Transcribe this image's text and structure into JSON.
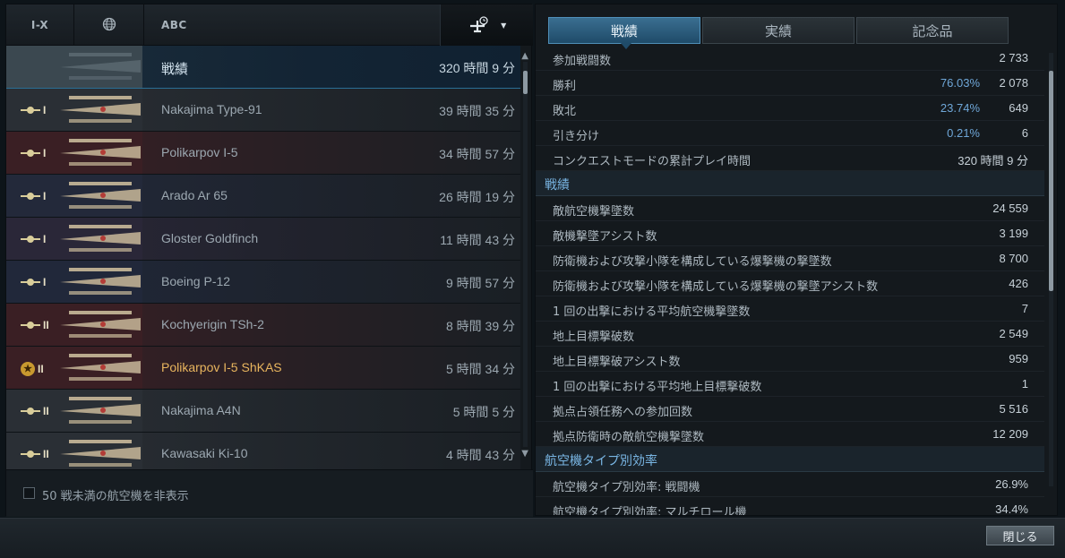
{
  "filters": {
    "tier_label": "I-X",
    "nation_icon": "globe-icon",
    "sort_label": "ABC",
    "sort_mode_icon": "plane-clock-icon"
  },
  "aircraft": [
    {
      "name": "戦績",
      "time": "320 時間 9 分",
      "tier": "",
      "type": "summary"
    },
    {
      "name": "Nakajima Type-91",
      "time": "39 時間 35 分",
      "tier": "I",
      "type": "normal",
      "tint": "#2a2f35"
    },
    {
      "name": "Polikarpov I-5",
      "time": "34 時間 57 分",
      "tier": "I",
      "type": "normal",
      "tint": "#3a1f24"
    },
    {
      "name": "Arado Ar 65",
      "time": "26 時間 19 分",
      "tier": "I",
      "type": "normal",
      "tint": "#23293a"
    },
    {
      "name": "Gloster Goldfinch",
      "time": "11 時間 43 分",
      "tier": "I",
      "type": "normal",
      "tint": "#2a2738"
    },
    {
      "name": "Boeing P-12",
      "time": "9 時間 57 分",
      "tier": "I",
      "type": "normal",
      "tint": "#21283a"
    },
    {
      "name": "Kochyerigin TSh-2",
      "time": "8 時間 39 分",
      "tier": "II",
      "type": "normal",
      "tint": "#3a1f24"
    },
    {
      "name": "Polikarpov I-5 ShKAS",
      "time": "5 時間 34 分",
      "tier": "II",
      "type": "premium",
      "tint": "#3a1f24"
    },
    {
      "name": "Nakajima A4N",
      "time": "5 時間 5 分",
      "tier": "II",
      "type": "normal",
      "tint": "#2a2f35"
    },
    {
      "name": "Kawasaki Ki-10",
      "time": "4 時間 43 分",
      "tier": "II",
      "type": "normal",
      "tint": "#2a2f35"
    }
  ],
  "hide_low_battles": {
    "label": "50 戦未満の航空機を非表示",
    "checked": false
  },
  "tabs": [
    {
      "label": "戦績",
      "active": true
    },
    {
      "label": "実績",
      "active": false
    },
    {
      "label": "記念品",
      "active": false
    }
  ],
  "stats": [
    {
      "kind": "row",
      "label": "参加戦闘数",
      "pct": "",
      "value": "2 733"
    },
    {
      "kind": "row",
      "label": "勝利",
      "pct": "76.03%",
      "value": "2 078"
    },
    {
      "kind": "row",
      "label": "敗北",
      "pct": "23.74%",
      "value": "649"
    },
    {
      "kind": "row",
      "label": "引き分け",
      "pct": "0.21%",
      "value": "6"
    },
    {
      "kind": "row",
      "label": "コンクエストモードの累計プレイ時間",
      "pct": "",
      "value": "320 時間 9 分"
    },
    {
      "kind": "section",
      "label": "戦績"
    },
    {
      "kind": "row",
      "label": "敵航空機撃墜数",
      "pct": "",
      "value": "24 559"
    },
    {
      "kind": "row",
      "label": "敵機撃墜アシスト数",
      "pct": "",
      "value": "3 199"
    },
    {
      "kind": "row",
      "label": "防衛機および攻撃小隊を構成している爆撃機の撃墜数",
      "pct": "",
      "value": "8 700"
    },
    {
      "kind": "row",
      "label": "防衛機および攻撃小隊を構成している爆撃機の撃墜アシスト数",
      "pct": "",
      "value": "426"
    },
    {
      "kind": "row",
      "label": "1 回の出撃における平均航空機撃墜数",
      "pct": "",
      "value": "7"
    },
    {
      "kind": "row",
      "label": "地上目標撃破数",
      "pct": "",
      "value": "2 549"
    },
    {
      "kind": "row",
      "label": "地上目標撃破アシスト数",
      "pct": "",
      "value": "959"
    },
    {
      "kind": "row",
      "label": "1 回の出撃における平均地上目標撃破数",
      "pct": "",
      "value": "1"
    },
    {
      "kind": "row",
      "label": "拠点占領任務への参加回数",
      "pct": "",
      "value": "5 516"
    },
    {
      "kind": "row",
      "label": "拠点防衛時の敵航空機撃墜数",
      "pct": "",
      "value": "12 209"
    },
    {
      "kind": "section",
      "label": "航空機タイプ別効率"
    },
    {
      "kind": "row",
      "label": "航空機タイプ別効率: 戦闘機",
      "pct": "",
      "value": "26.9%"
    },
    {
      "kind": "row",
      "label": "航空機タイプ別効率: マルチロール機",
      "pct": "",
      "value": "34.4%"
    }
  ],
  "footer": {
    "close_label": "閉じる"
  }
}
